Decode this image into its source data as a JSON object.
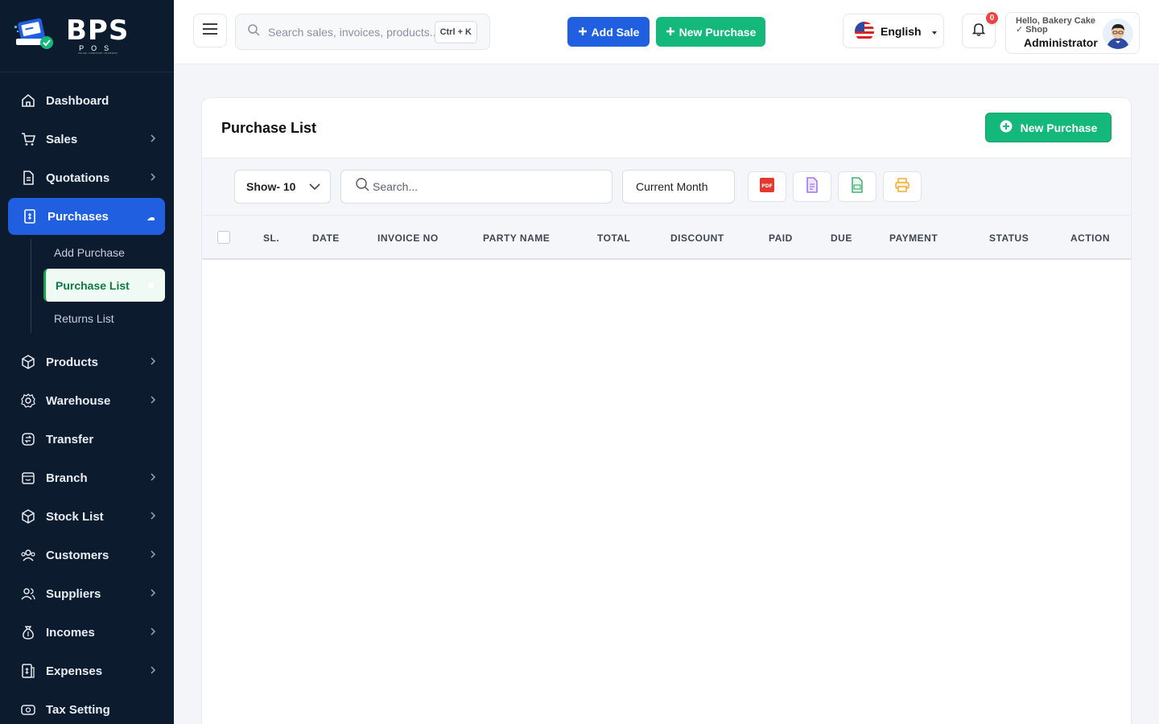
{
  "brand": {
    "title": "BPS",
    "subtitle": "POS",
    "tagline": "ONLINE • INVENTORY • BUSINESS",
    "accent": "#1f5fe0",
    "green": "#14b87a"
  },
  "sidebar": {
    "items": [
      {
        "label": "Dashboard",
        "icon": "home-icon",
        "chevron": false
      },
      {
        "label": "Sales",
        "icon": "cart-icon",
        "chevron": true
      },
      {
        "label": "Quotations",
        "icon": "document-icon",
        "chevron": true
      },
      {
        "label": "Purchases",
        "icon": "receipt-icon",
        "chevron": false,
        "active": true
      },
      {
        "label": "Products",
        "icon": "box-icon",
        "chevron": true
      },
      {
        "label": "Warehouse",
        "icon": "warehouse-icon",
        "chevron": true
      },
      {
        "label": "Transfer",
        "icon": "transfer-icon",
        "chevron": false
      },
      {
        "label": "Branch",
        "icon": "store-icon",
        "chevron": true
      },
      {
        "label": "Stock List",
        "icon": "cube-icon",
        "chevron": true
      },
      {
        "label": "Customers",
        "icon": "users-icon",
        "chevron": true
      },
      {
        "label": "Suppliers",
        "icon": "user-group-icon",
        "chevron": true
      },
      {
        "label": "Incomes",
        "icon": "money-bag-icon",
        "chevron": true
      },
      {
        "label": "Expenses",
        "icon": "expense-icon",
        "chevron": true
      },
      {
        "label": "Tax Setting",
        "icon": "tax-icon",
        "chevron": false
      }
    ],
    "purchases_sub": [
      {
        "label": "Add Purchase"
      },
      {
        "label": "Purchase List",
        "active": true
      },
      {
        "label": "Returns List"
      }
    ]
  },
  "topbar": {
    "search_placeholder": "Search sales, invoices, products...",
    "shortcut": "Ctrl + K",
    "add_sale": "Add Sale",
    "new_purchase": "New Purchase",
    "language": "English",
    "notification_count": "0",
    "greeting": "Hello, Bakery Cake ✓ Shop",
    "role": "Administrator"
  },
  "page": {
    "title": "Purchase List",
    "new_button": "New Purchase",
    "show_label": "Show- 10",
    "search_placeholder": "Search...",
    "period": "Current Month",
    "exports": [
      "PDF",
      "document-icon",
      "csv-icon",
      "printer-icon"
    ],
    "columns": [
      "SL.",
      "DATE",
      "INVOICE NO",
      "PARTY NAME",
      "TOTAL",
      "DISCOUNT",
      "PAID",
      "DUE",
      "PAYMENT",
      "STATUS",
      "ACTION"
    ],
    "rows": []
  }
}
